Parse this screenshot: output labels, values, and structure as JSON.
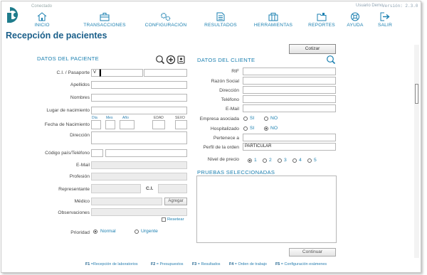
{
  "header": {
    "connection_status": "Conectado",
    "user": "Usuario Demo",
    "version": "Versión: 2.3.0"
  },
  "nav": [
    {
      "label": "INICIO",
      "icon": "home-icon"
    },
    {
      "label": "TRANSACCIONES",
      "icon": "briefcase-icon"
    },
    {
      "label": "CONFIGURACIÓN",
      "icon": "gears-icon"
    },
    {
      "label": "RESULTADOS",
      "icon": "document-icon"
    },
    {
      "label": "HERRAMIENTAS",
      "icon": "toolbox-icon"
    },
    {
      "label": "REPORTES",
      "icon": "folder-icon"
    },
    {
      "label": "AYUDA",
      "icon": "help-icon"
    },
    {
      "label": "SALIR",
      "icon": "exit-icon"
    }
  ],
  "page": {
    "title": "Recepción de pacientes",
    "cotizar": "Cotizar",
    "continuar": "Continuar"
  },
  "patient": {
    "heading": "DATOS DEL PACIENTE",
    "ci_label": "C.I. / Pasaporte",
    "ci_prefix": "V",
    "apellidos": "Apellidos",
    "nombres": "Nombres",
    "lugar_nac": "Lugar de nacimiento",
    "fecha_nac": "Fecha de Nacimiento",
    "dia": "Día",
    "mes": "Mes",
    "anio": "Año",
    "edad": "EDAD",
    "sexo": "SEXO",
    "direccion": "Dirección",
    "codigo_tel": "Código país/Teléfono",
    "email": "E-Mail",
    "profesion": "Profesión",
    "representante": "Representante",
    "ci_short": "C.I.",
    "medico": "Médico",
    "agregar": "Agregar",
    "observaciones": "Observaciones",
    "resetear": "Resetear",
    "prioridad": "Prioridad",
    "normal": "Normal",
    "urgente": "Urgente"
  },
  "client": {
    "heading": "DATOS DEL CLIENTE",
    "rif": "RIF",
    "razon_social": "Razón Social",
    "direccion": "Dirección",
    "telefono": "Teléfono",
    "email": "E-Mail",
    "empresa_asociada": "Empresa asociada",
    "hospitalizado": "Hospitalizado",
    "si": "SI",
    "no": "NO",
    "pertenece_a": "Pertenece a",
    "perfil_orden": "Perfil de la orden",
    "perfil_value": "PARTICULAR",
    "nivel_precio": "Nivel de precio",
    "niveles": [
      "1",
      "2",
      "3",
      "4",
      "5"
    ],
    "pruebas": "PRUEBAS SELECCIONADAS"
  },
  "fkeys": [
    {
      "key": "F1",
      "label": "=Recepción de laboratorios"
    },
    {
      "key": "F2",
      "label": "= Presupuestos"
    },
    {
      "key": "F3",
      "label": "= Resultados"
    },
    {
      "key": "F4",
      "label": "= Orden de trabajo"
    },
    {
      "key": "F5",
      "label": "= Configuración exámenes"
    }
  ],
  "colors": {
    "accent": "#1a7fb0",
    "title": "#1a5f8a",
    "logo": "#1f7c8c"
  }
}
